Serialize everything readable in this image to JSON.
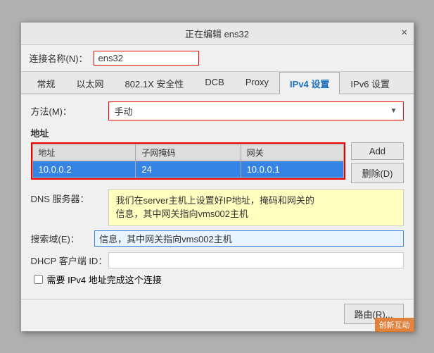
{
  "titleBar": {
    "title": "正在编辑 ens32",
    "closeLabel": "×"
  },
  "connectionName": {
    "label": "连接名称(N)：",
    "value": "ens32"
  },
  "tabs": [
    {
      "id": "general",
      "label": "常规",
      "active": false
    },
    {
      "id": "ethernet",
      "label": "以太网",
      "active": false
    },
    {
      "id": "security",
      "label": "802.1X 安全性",
      "active": false
    },
    {
      "id": "dcb",
      "label": "DCB",
      "active": false
    },
    {
      "id": "proxy",
      "label": "Proxy",
      "active": false
    },
    {
      "id": "ipv4",
      "label": "IPv4 设置",
      "active": true
    },
    {
      "id": "ipv6",
      "label": "IPv6 设置",
      "active": false
    }
  ],
  "method": {
    "label": "方法(M)：",
    "value": "手动"
  },
  "addressSection": {
    "title": "地址",
    "columns": [
      "地址",
      "子网掩码",
      "网关"
    ],
    "rows": [
      {
        "address": "10.0.0.2",
        "mask": "24",
        "gateway": "10.0.0.1"
      }
    ],
    "addButton": "Add",
    "deleteButton": "删除(D)"
  },
  "dns": {
    "label": "DNS 服务器：",
    "tooltip": "我们在server主机上设置好IP地址，掩码和网关的\n信息，其中网关指向vms002主机"
  },
  "search": {
    "label": "搜索域(E)：",
    "value": "信息，其中网关指向vms002主机"
  },
  "dhcp": {
    "label": "DHCP 客户端 ID：",
    "value": ""
  },
  "checkbox": {
    "label": "需要 IPv4 地址完成这个连接"
  },
  "footer": {
    "routeButton": "路由(R)..."
  },
  "watermark": "创新互动"
}
